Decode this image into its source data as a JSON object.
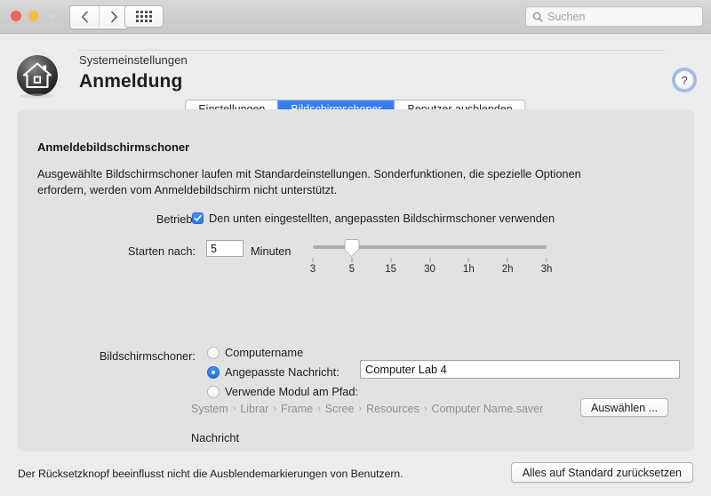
{
  "titlebar": {
    "traffic_lights": [
      "close",
      "minimize",
      "zoom"
    ],
    "back_label": "‹",
    "forward_label": "›",
    "grid_label": "Alle anzeigen",
    "search": {
      "value": "",
      "placeholder": "Suchen"
    }
  },
  "header": {
    "app_name": "Systemeinstellungen",
    "title": "Anmeldung",
    "help_label": "?",
    "home_icon": "home-icon"
  },
  "tabs": [
    {
      "label": "Einstellungen",
      "active": false
    },
    {
      "label": "Bildschirmschoner",
      "active": true
    },
    {
      "label": "Benutzer ausblenden",
      "active": false
    }
  ],
  "panel": {
    "section_title": "Anmeldebildschirmschoner",
    "description": "Ausgewählte Bildschirmschoner laufen mit Standardeinstellungen. Sonderfunktionen, die spezielle Optionen erfordern, werden vom Anmeldebildschirm nicht unterstützt.",
    "operation": {
      "label": "Betrieb:",
      "checkbox_checked": true,
      "checkbox_label": "Den unten eingestellten, angepassten Bildschirmschoner verwenden"
    },
    "start_after": {
      "label": "Starten nach:",
      "value": "5",
      "unit": "Minuten",
      "slider": {
        "ticks": [
          "3",
          "5",
          "15",
          "30",
          "1h",
          "2h",
          "3h"
        ],
        "thumb_index": 1
      }
    },
    "screensaver": {
      "label": "Bildschirmschoner:",
      "options": [
        {
          "label": "Computername",
          "selected": false
        },
        {
          "label": "Angepasste Nachricht:",
          "selected": true
        },
        {
          "label": "Verwende Modul am Pfad:",
          "selected": false
        }
      ],
      "message_value": "Computer Lab 4",
      "breadcrumb": [
        "System",
        "Librar",
        "Frame",
        "Scree",
        "Resources",
        "Computer Name.saver"
      ],
      "breadcrumb_separator": "›",
      "choose_button": "Auswählen ...",
      "message_caption": "Nachricht"
    }
  },
  "footer": {
    "note": "Der Rücksetzknopf beeinflusst nicht die Ausblendemarkierungen von Benutzern.",
    "reset_button": "Alles auf Standard zurücksetzen"
  },
  "colors": {
    "accent": "#2c77e8",
    "tab_active": "#2b79ef",
    "window_bg": "#ececec",
    "panel_bg": "#e2e2e2"
  }
}
